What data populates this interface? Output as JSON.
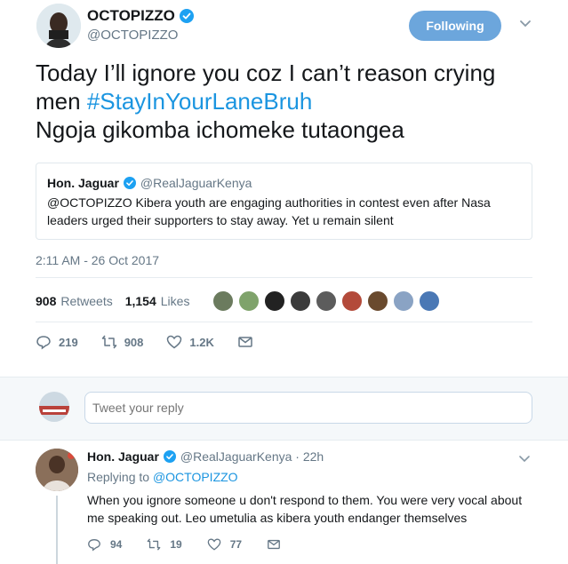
{
  "tweet": {
    "display_name": "OCTOPIZZO",
    "handle": "@OCTOPIZZO",
    "follow_label": "Following",
    "text_line1": "Today I’ll ignore you coz I can’t reason crying",
    "text_line2_prefix": "men ",
    "hashtag": "#StayInYourLaneBruh",
    "text_line3": "Ngoja gikomba ichomeke tutaongea",
    "timestamp": "2:11 AM - 26 Oct 2017",
    "retweets_count": "908",
    "retweets_label": "Retweets",
    "likes_count": "1,154",
    "likes_label": "Likes",
    "reply_count": "219",
    "retweet_action_count": "908",
    "like_action_count": "1.2K"
  },
  "quoted": {
    "name": "Hon. Jaguar",
    "handle": "@RealJaguarKenya",
    "text": "@OCTOPIZZO Kibera youth are engaging authorities in contest even after Nasa leaders urged their supporters to stay away. Yet u remain silent"
  },
  "reply_box": {
    "placeholder": "Tweet your reply"
  },
  "reply": {
    "name": "Hon. Jaguar",
    "handle_time": "@RealJaguarKenya · 22h",
    "replying_prefix": "Replying to",
    "replying_to": "@OCTOPIZZO",
    "text": "When you ignore someone u don't respond to them. You were very vocal about me speaking out. Leo umetulia as kibera youth endanger themselves",
    "reply_count": "94",
    "retweet_count": "19",
    "like_count": "77"
  },
  "liker_avatars": [
    "avatar-1",
    "avatar-2",
    "avatar-3",
    "avatar-4",
    "avatar-5",
    "avatar-6",
    "avatar-7",
    "avatar-8",
    "avatar-9"
  ],
  "colors": {
    "accent": "#1b95e0",
    "follow_button": "#6ca6dc",
    "muted": "#657786",
    "verified": "#1da1f2"
  }
}
